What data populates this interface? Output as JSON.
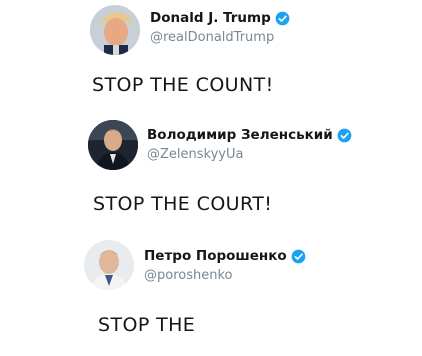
{
  "tweets": [
    {
      "name": "Donald J. Trump",
      "handle": "@realDonaldTrump",
      "text": "STOP THE COUNT!",
      "verified": true,
      "avatar_icon": "user-avatar"
    },
    {
      "name": "Володимир Зеленський",
      "handle": "@ZelenskyyUa",
      "text": "STOP THE COURT!",
      "verified": true,
      "avatar_icon": "user-avatar"
    },
    {
      "name": "Петро Порошенко",
      "handle": "@poroshenko",
      "text": "STOP THE",
      "verified": true,
      "avatar_icon": "user-avatar"
    }
  ],
  "colors": {
    "verified_badge": "#1da1f2",
    "handle_text": "#7a8791",
    "body_text": "#14171a"
  }
}
